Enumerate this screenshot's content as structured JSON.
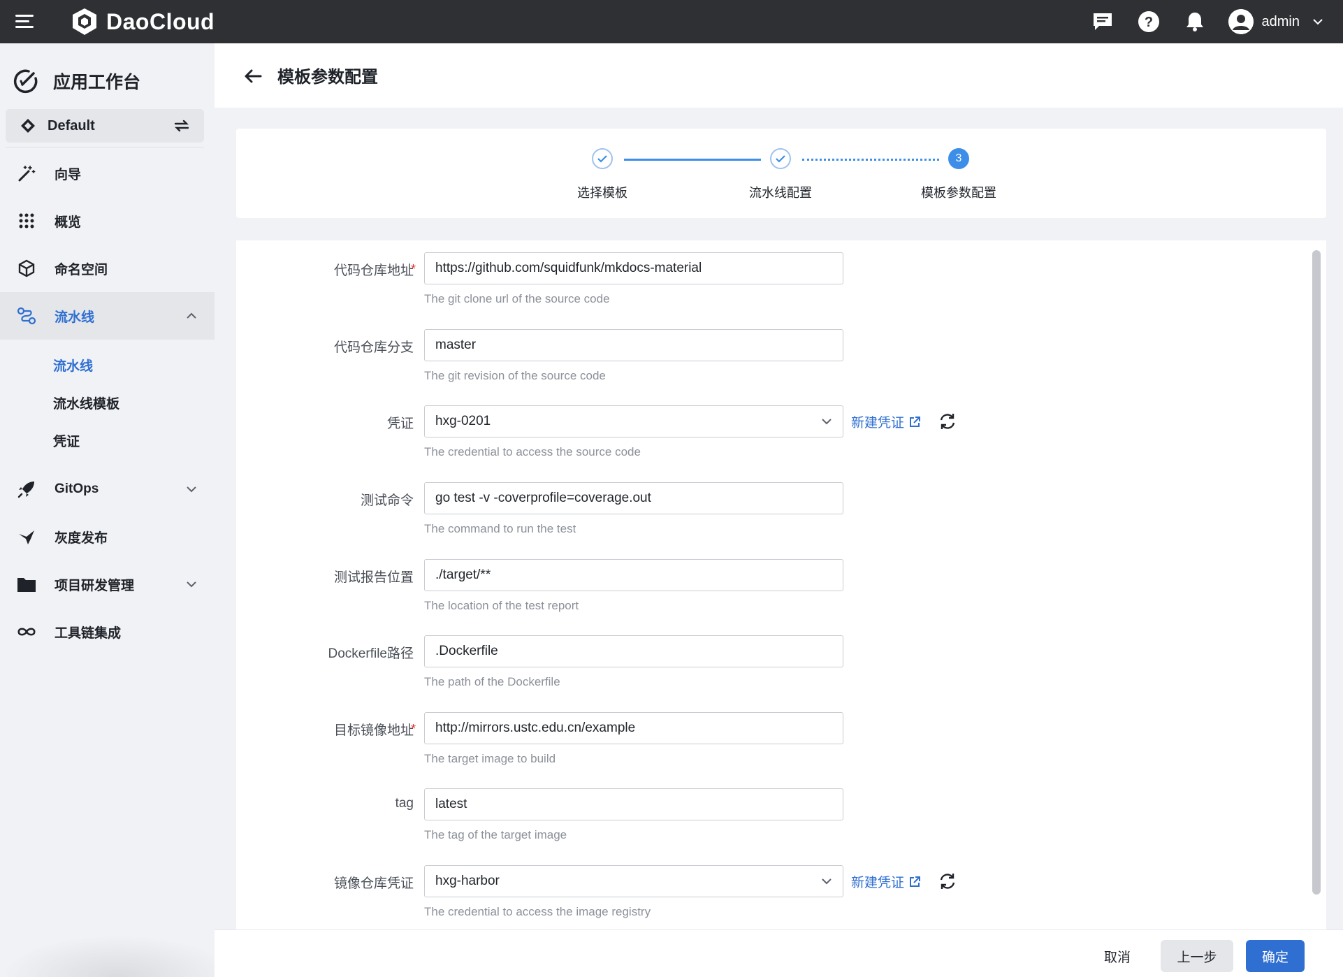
{
  "topbar": {
    "brand": "DaoCloud",
    "user": "admin",
    "icons": [
      "menu-icon",
      "message-icon",
      "help-icon",
      "bell-icon",
      "user-avatar-icon",
      "chevron-down-icon"
    ]
  },
  "sidebar": {
    "app_title": "应用工作台",
    "workspace": "Default",
    "items": [
      {
        "label": "向导",
        "icon": "magic-wand-icon"
      },
      {
        "label": "概览",
        "icon": "grid-dots-icon"
      },
      {
        "label": "命名空间",
        "icon": "cube-icon"
      },
      {
        "label": "流水线",
        "icon": "pipeline-icon"
      },
      {
        "label": "GitOps",
        "icon": "rocket-icon"
      },
      {
        "label": "灰度发布",
        "icon": "bird-icon"
      },
      {
        "label": "项目研发管理",
        "icon": "folder-icon"
      },
      {
        "label": "工具链集成",
        "icon": "infinity-icon"
      }
    ],
    "sub_items": [
      "流水线",
      "流水线模板",
      "凭证"
    ]
  },
  "header": {
    "title": "模板参数配置"
  },
  "steps": [
    {
      "label": "选择模板",
      "status": "done"
    },
    {
      "label": "流水线配置",
      "status": "done"
    },
    {
      "label": "模板参数配置",
      "status": "current",
      "number": "3"
    }
  ],
  "form": {
    "fields": [
      {
        "label": "代码仓库地址",
        "required": true,
        "value": "https://github.com/squidfunk/mkdocs-material",
        "hint": "The git clone url of the source code"
      },
      {
        "label": "代码仓库分支",
        "required": false,
        "value": "master",
        "hint": "The git revision of the source code"
      },
      {
        "label": "凭证",
        "required": false,
        "value": "hxg-0201",
        "hint": "The credential to access the source code"
      },
      {
        "label": "测试命令",
        "required": false,
        "value": "go test -v -coverprofile=coverage.out",
        "hint": "The command to run the test"
      },
      {
        "label": "测试报告位置",
        "required": false,
        "value": "./target/**",
        "hint": "The location of the test report"
      },
      {
        "label": "Dockerfile路径",
        "required": false,
        "value": ".Dockerfile",
        "hint": "The path of the Dockerfile"
      },
      {
        "label": "目标镜像地址",
        "required": true,
        "value": "http://mirrors.ustc.edu.cn/example",
        "hint": "The target image to build"
      },
      {
        "label": "tag",
        "required": false,
        "value": "latest",
        "hint": "The tag of the target image"
      },
      {
        "label": "镜像仓库凭证",
        "required": false,
        "value": "hxg-harbor",
        "hint": "The credential to access the image registry"
      }
    ],
    "new_credential_link": "新建凭证",
    "required_mark": "*"
  },
  "footer": {
    "cancel": "取消",
    "prev": "上一步",
    "confirm": "确定"
  },
  "colors": {
    "accent": "#2f6fd1",
    "topbar": "#2f3034",
    "step": "#3d8ee8",
    "required": "#e0342f"
  }
}
